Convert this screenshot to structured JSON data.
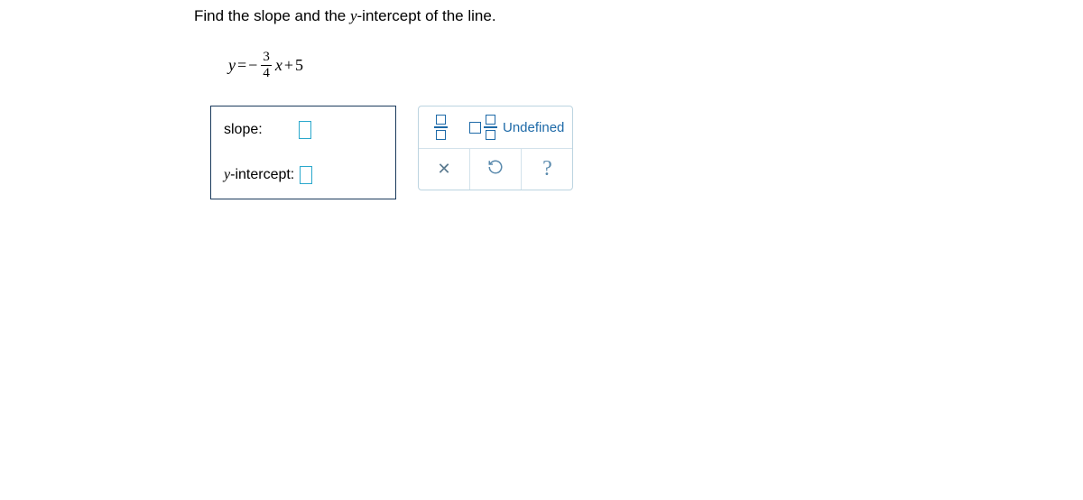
{
  "prompt": {
    "text_before": "Find the slope and the ",
    "var": "y",
    "text_after": "-intercept of the line."
  },
  "equation": {
    "lhs_var": "y",
    "equals": "=",
    "neg": "−",
    "frac_num": "3",
    "frac_den": "4",
    "rhs_var": "x",
    "plus": "+",
    "constant": "5"
  },
  "answers": {
    "slope_label": "slope:",
    "yintercept_var": "y",
    "yintercept_label": "-intercept:"
  },
  "keypad": {
    "undefined_label": "Undefined",
    "help_symbol": "?"
  }
}
